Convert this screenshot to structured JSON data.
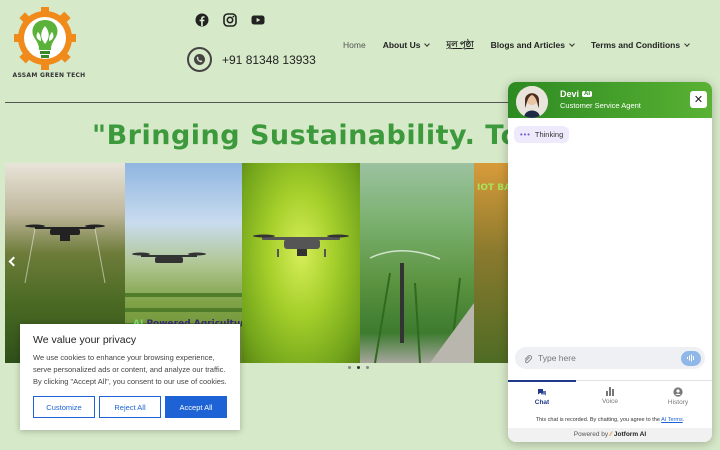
{
  "brand": {
    "logo_text": "ASSAM GREEN TECH"
  },
  "contact": {
    "phone": "+91 81348 13933"
  },
  "nav": {
    "items": [
      {
        "label": "Home",
        "dropdown": false
      },
      {
        "label": "About Us",
        "dropdown": true
      },
      {
        "label": "মূল পৃষ্ঠা",
        "dropdown": false
      },
      {
        "label": "Blogs and Articles",
        "dropdown": true
      },
      {
        "label": "Terms and Conditions",
        "dropdown": true
      }
    ]
  },
  "hero": {
    "title": "\"Bringing Sustainability. To"
  },
  "slider": {
    "ai_label_prefix": "AI",
    "ai_label_rest": " Powered Agriculture",
    "iot_label": "IOT BA",
    "active_dot": 1
  },
  "cookie": {
    "title": "We value your privacy",
    "text": "We use cookies to enhance your browsing experience, serve personalized ads or content, and analyze our traffic. By clicking \"Accept All\", you consent to our use of cookies.",
    "customize": "Customize",
    "reject": "Reject All",
    "accept": "Accept All"
  },
  "chat": {
    "agent_name": "Devi",
    "ai_badge": "AI",
    "agent_role": "Customer Service Agent",
    "close": "✕",
    "status": "Thinking",
    "input_placeholder": "Type here",
    "tabs": [
      "Chat",
      "Voice",
      "History"
    ],
    "terms_prefix": "This chat is recorded. By chatting, you agree to the ",
    "terms_link": "AI Terms",
    "terms_suffix": ".",
    "powered_prefix": "Powered by ",
    "powered_brand": "Jotform AI"
  },
  "colors": {
    "accent_green": "#3c9a3c",
    "cookie_blue": "#1d63d6",
    "chat_header": "#2d8a22"
  }
}
